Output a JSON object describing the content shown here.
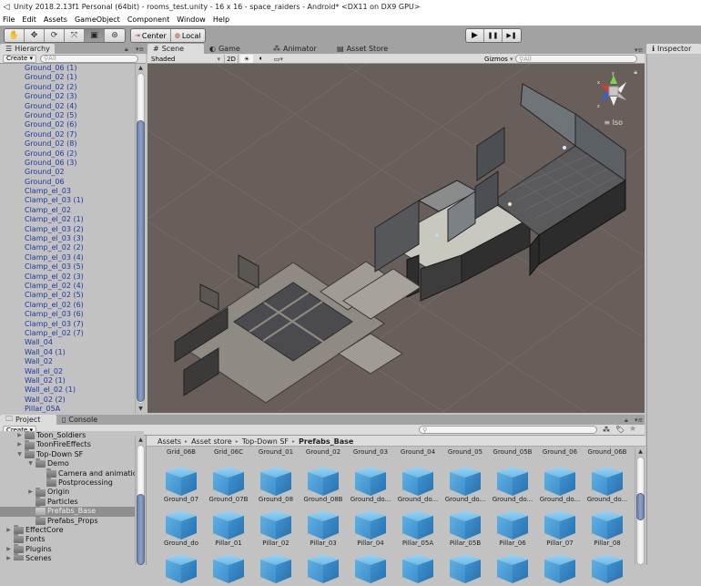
{
  "window": {
    "title": "Unity 2018.2.13f1 Personal (64bit) - rooms_test.unity - 16 x 16 - space_raiders - Android* <DX11 on DX9 GPU>"
  },
  "menu": [
    "File",
    "Edit",
    "Assets",
    "GameObject",
    "Component",
    "Window",
    "Help"
  ],
  "toolbar": {
    "tools": [
      {
        "name": "hand-tool",
        "glyph": "✋"
      },
      {
        "name": "move-tool",
        "glyph": "✥"
      },
      {
        "name": "rotate-tool",
        "glyph": "⟳"
      },
      {
        "name": "scale-tool",
        "glyph": "⤧"
      },
      {
        "name": "rect-tool",
        "glyph": "▣",
        "active": true
      },
      {
        "name": "transform-tool",
        "glyph": "⊛"
      }
    ],
    "pivot": {
      "center_label": "Center",
      "local_label": "Local"
    },
    "play": {
      "play": "▶",
      "pause": "❚❚",
      "step": "▶❚"
    }
  },
  "hierarchy": {
    "tab_label": "Hierarchy",
    "create_label": "Create",
    "search_placeholder": "All",
    "items": [
      "Ground_06 (1)",
      "Ground_02 (1)",
      "Ground_02 (2)",
      "Ground_02 (3)",
      "Ground_02 (4)",
      "Ground_02 (5)",
      "Ground_02 (6)",
      "Ground_02 (7)",
      "Ground_02 (8)",
      "Ground_06 (2)",
      "Ground_06 (3)",
      "Ground_02",
      "Ground_06",
      "Clamp_el_03",
      "Clamp_el_03 (1)",
      "Clamp_el_02",
      "Clamp_el_02 (1)",
      "Clamp_el_03 (2)",
      "Clamp_el_03 (3)",
      "Clamp_el_02 (2)",
      "Clamp_el_03 (4)",
      "Clamp_el_03 (5)",
      "Clamp_el_02 (3)",
      "Clamp_el_02 (4)",
      "Clamp_el_02 (5)",
      "Clamp_el_02 (6)",
      "Clamp_el_03 (6)",
      "Clamp_el_03 (7)",
      "Clamp_el_02 (7)",
      "Wall_04",
      "Wall_04 (1)",
      "Wall_02",
      "Wall_el_02",
      "Wall_02 (1)",
      "Wall_el_02 (1)",
      "Wall_02 (2)",
      "Pillar_05A"
    ]
  },
  "scene": {
    "tabs": [
      {
        "label": "Scene",
        "icon": "#",
        "active": true
      },
      {
        "label": "Game",
        "icon": "◐"
      },
      {
        "label": "Animator",
        "icon": "⁂"
      },
      {
        "label": "Asset Store",
        "icon": "▤"
      }
    ],
    "shading_mode": "Shaded",
    "mode_2d_label": "2D",
    "gizmos_label": "Gizmos",
    "search_placeholder": "All",
    "projection_label": "Iso",
    "axis_labels": {
      "x": "x",
      "y": "y",
      "z": "z"
    }
  },
  "inspector": {
    "tab_label": "Inspector"
  },
  "project": {
    "tabs": [
      {
        "label": "Project",
        "active": true
      },
      {
        "label": "Console"
      }
    ],
    "create_label": "Create",
    "tree": [
      {
        "label": "Toon_Soldiers",
        "depth": 1,
        "expand": "collapsed"
      },
      {
        "label": "ToonFireEffects",
        "depth": 1,
        "expand": "collapsed"
      },
      {
        "label": "Top-Down SF",
        "depth": 1,
        "expand": "expanded"
      },
      {
        "label": "Demo",
        "depth": 2,
        "expand": "expanded"
      },
      {
        "label": "Camera and animation",
        "depth": 3,
        "expand": "none"
      },
      {
        "label": "Postprocessing",
        "depth": 3,
        "expand": "none"
      },
      {
        "label": "Origin",
        "depth": 2,
        "expand": "collapsed"
      },
      {
        "label": "Particles",
        "depth": 2,
        "expand": "none"
      },
      {
        "label": "Prefabs_Base",
        "depth": 2,
        "expand": "none",
        "selected": true
      },
      {
        "label": "Prefabs_Props",
        "depth": 2,
        "expand": "none"
      },
      {
        "label": "EffectCore",
        "depth": 0,
        "expand": "collapsed"
      },
      {
        "label": "Fonts",
        "depth": 0,
        "expand": "none"
      },
      {
        "label": "Plugins",
        "depth": 0,
        "expand": "collapsed"
      },
      {
        "label": "Scenes",
        "depth": 0,
        "expand": "collapsed"
      }
    ],
    "breadcrumb": [
      "Assets",
      "Asset store",
      "Top-Down SF",
      "Prefabs_Base"
    ],
    "asset_rows": [
      [
        "Grid_06B",
        "Grid_06C",
        "Ground_01",
        "Ground_02",
        "Ground_03",
        "Ground_04",
        "Ground_05",
        "Ground_05B",
        "Ground_06",
        "Ground_06B"
      ],
      [
        "Ground_07",
        "Ground_07B",
        "Ground_08",
        "Ground_08B",
        "Ground_do...",
        "Ground_do...",
        "Ground_do...",
        "Ground_do...",
        "Ground_do...",
        "Ground_do..."
      ],
      [
        "Ground_do",
        "Pillar_01",
        "Pillar_02",
        "Pillar_03",
        "Pillar_04",
        "Pillar_05A",
        "Pillar_05B",
        "Pillar_06",
        "Pillar_07",
        "Pillar_08"
      ]
    ]
  },
  "colors": {
    "hierarchy_text": "#1d3aa1",
    "scene_bg": "#685f5b",
    "scrollbar_thumb": "#7b90b5",
    "cube": "#4aa3dc"
  }
}
